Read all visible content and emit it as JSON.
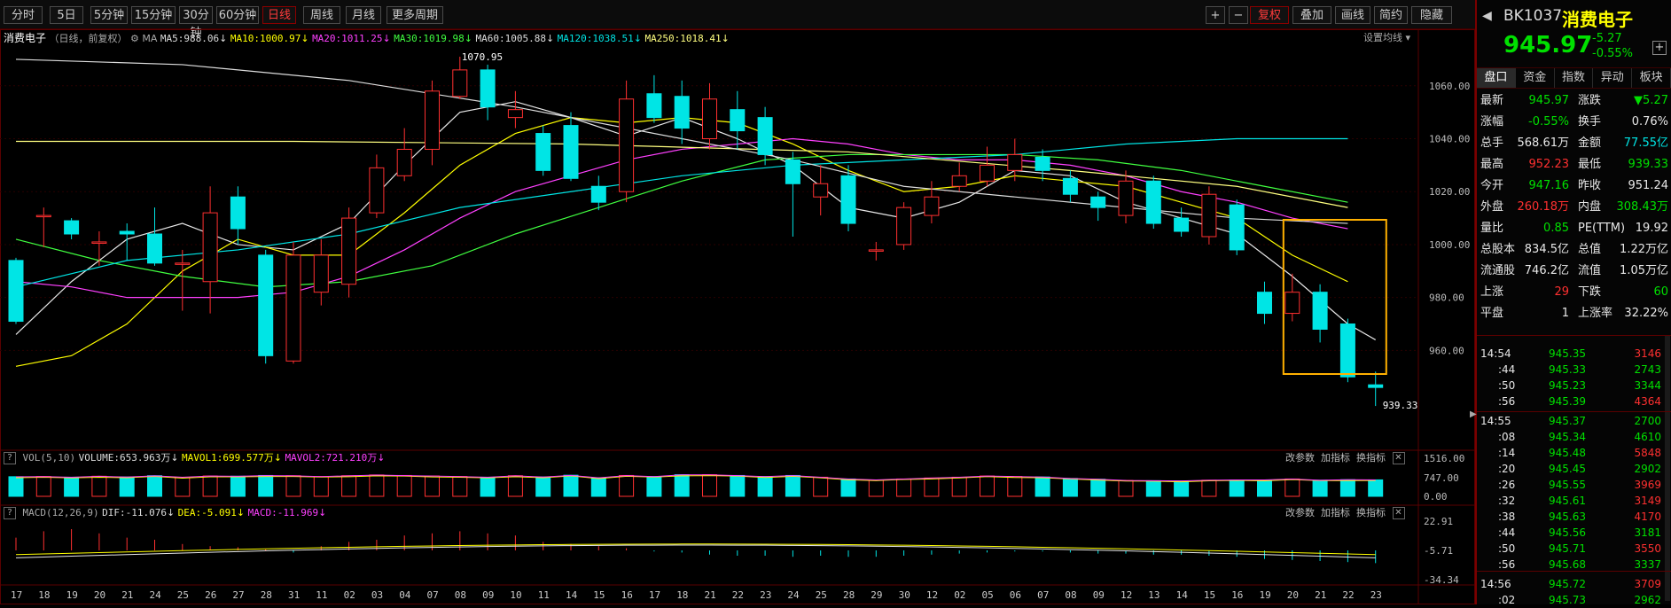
{
  "toolbar": {
    "periods": [
      "分时",
      "5日",
      "5分钟",
      "15分钟",
      "30分钟",
      "60分钟",
      "日线",
      "周线",
      "月线",
      "更多周期"
    ],
    "right_buttons": [
      "+",
      "−",
      "复权",
      "叠加",
      "画线",
      "简约",
      "隐藏"
    ]
  },
  "main_header": {
    "name": "消费电子",
    "mode": "（日线，前复权）",
    "ma_label": "MA",
    "ma5": "MA5:988.06",
    "ma10": "MA10:1000.97",
    "ma20": "MA20:1011.25",
    "ma30": "MA30:1019.98",
    "ma60": "MA60:1005.88",
    "ma120": "MA120:1038.51",
    "ma250": "MA250:1018.41",
    "settings": "设置均线"
  },
  "price_axis": [
    "1060.00",
    "1040.00",
    "1020.00",
    "1000.00",
    "980.00",
    "960.00"
  ],
  "annotations": {
    "high": "1070.95",
    "low": "939.33"
  },
  "vol_header": {
    "label": "VOL(5,10)",
    "volume": "VOLUME:653.963万",
    "mavol1": "MAVOL1:699.577万",
    "mavol2": "MAVOL2:721.210万",
    "actions": [
      "改参数",
      "加指标",
      "换指标"
    ]
  },
  "vol_axis": [
    "1516.00",
    "747.00",
    "0.00"
  ],
  "macd_header": {
    "label": "MACD(12,26,9)",
    "dif": "DIF:-11.076",
    "dea": "DEA:-5.091",
    "macd": "MACD:-11.969",
    "actions": [
      "改参数",
      "加指标",
      "换指标"
    ]
  },
  "macd_axis": [
    "22.91",
    "-5.71",
    "-34.34"
  ],
  "date_axis": [
    "17",
    "18",
    "19",
    "20",
    "21",
    "24",
    "25",
    "26",
    "27",
    "28",
    "31",
    "11",
    "02",
    "03",
    "04",
    "07",
    "08",
    "09",
    "10",
    "11",
    "14",
    "15",
    "16",
    "17",
    "18",
    "21",
    "22",
    "23",
    "24",
    "25",
    "28",
    "29",
    "30",
    "12",
    "02",
    "05",
    "06",
    "07",
    "08",
    "09",
    "12",
    "13",
    "14",
    "15",
    "16",
    "19",
    "20",
    "21",
    "22",
    "23"
  ],
  "stock": {
    "code": "BK1037",
    "name": "消费电子",
    "price": "945.97",
    "change": "-5.27",
    "change_pct": "-0.55%"
  },
  "right_tabs": [
    "盘口",
    "资金",
    "指数",
    "异动",
    "板块"
  ],
  "quote_rows": [
    {
      "l1": "最新",
      "v1": "945.97",
      "c1": "green",
      "l2": "涨跌",
      "v2": "▼5.27",
      "c2": "green"
    },
    {
      "l1": "涨幅",
      "v1": "-0.55%",
      "c1": "green",
      "l2": "换手",
      "v2": "0.76%",
      "c2": "white"
    },
    {
      "l1": "总手",
      "v1": "568.61万",
      "c1": "white",
      "l2": "金额",
      "v2": "77.55亿",
      "c2": "cyan"
    },
    {
      "l1": "最高",
      "v1": "952.23",
      "c1": "red",
      "l2": "最低",
      "v2": "939.33",
      "c1b": "",
      "c2": "green"
    },
    {
      "l1": "今开",
      "v1": "947.16",
      "c1": "green",
      "l2": "昨收",
      "v2": "951.24",
      "c2": "white"
    },
    {
      "l1": "外盘",
      "v1": "260.18万",
      "c1": "red",
      "l2": "内盘",
      "v2": "308.43万",
      "c2": "green"
    },
    {
      "l1": "量比",
      "v1": "0.85",
      "c1": "green",
      "l2": "PE(TTM)",
      "v2": "19.92",
      "c2": "white"
    },
    {
      "l1": "总股本",
      "v1": "834.5亿",
      "c1": "white",
      "l2": "总值",
      "v2": "1.22万亿",
      "c2": "white"
    },
    {
      "l1": "流通股",
      "v1": "746.2亿",
      "c1": "white",
      "l2": "流值",
      "v2": "1.05万亿",
      "c2": "white"
    },
    {
      "l1": "上涨",
      "v1": "29",
      "c1": "red",
      "l2": "下跌",
      "v2": "60",
      "c2": "green"
    },
    {
      "l1": "平盘",
      "v1": "1",
      "c1": "white",
      "l2": "上涨率",
      "v2": "32.22%",
      "c2": "white"
    }
  ],
  "ticks": [
    {
      "t": "14:54",
      "p": "945.35",
      "v": "3146",
      "vc": "red"
    },
    {
      "t": ":44",
      "p": "945.33",
      "v": "2743",
      "vc": "green"
    },
    {
      "t": ":50",
      "p": "945.23",
      "v": "3344",
      "vc": "green"
    },
    {
      "t": ":56",
      "p": "945.39",
      "v": "4364",
      "vc": "red"
    },
    {
      "t": "14:55",
      "p": "945.37",
      "v": "2700",
      "vc": "green"
    },
    {
      "t": ":08",
      "p": "945.34",
      "v": "4610",
      "vc": "green"
    },
    {
      "t": ":14",
      "p": "945.48",
      "v": "5848",
      "vc": "red"
    },
    {
      "t": ":20",
      "p": "945.45",
      "v": "2902",
      "vc": "green"
    },
    {
      "t": ":26",
      "p": "945.55",
      "v": "3969",
      "vc": "red"
    },
    {
      "t": ":32",
      "p": "945.61",
      "v": "3149",
      "vc": "red"
    },
    {
      "t": ":38",
      "p": "945.63",
      "v": "4170",
      "vc": "red"
    },
    {
      "t": ":44",
      "p": "945.56",
      "v": "3181",
      "vc": "green"
    },
    {
      "t": ":50",
      "p": "945.71",
      "v": "3550",
      "vc": "red"
    },
    {
      "t": ":56",
      "p": "945.68",
      "v": "3337",
      "vc": "green"
    },
    {
      "t": "14:56",
      "p": "945.72",
      "v": "3709",
      "vc": "red"
    },
    {
      "t": ":02",
      "p": "945.73",
      "v": "2962",
      "vc": "green"
    }
  ],
  "chart_data": {
    "type": "candlestick",
    "ylim": [
      934,
      1074
    ],
    "candles": [
      [
        994,
        971,
        995,
        970
      ],
      [
        1011,
        1011,
        1014,
        999
      ],
      [
        1009,
        1004,
        1010,
        1002
      ],
      [
        1001,
        1001,
        1005,
        992
      ],
      [
        1005,
        1004,
        1008,
        994
      ],
      [
        1004,
        993,
        1014,
        992
      ],
      [
        993,
        993,
        998,
        975
      ],
      [
        986,
        1012,
        1022,
        974
      ],
      [
        1018,
        1006,
        1022,
        1000
      ],
      [
        996,
        958,
        998,
        955
      ],
      [
        956,
        996,
        1001,
        955
      ],
      [
        982,
        996,
        1002,
        977
      ],
      [
        985,
        1010,
        1014,
        980
      ],
      [
        1012,
        1029,
        1034,
        1010
      ],
      [
        1026,
        1036,
        1044,
        1024
      ],
      [
        1036,
        1058,
        1062,
        1030
      ],
      [
        1056,
        1066,
        1071,
        1055
      ],
      [
        1066,
        1052,
        1068,
        1047
      ],
      [
        1048,
        1051,
        1058,
        1044
      ],
      [
        1042,
        1028,
        1045,
        1026
      ],
      [
        1045,
        1025,
        1050,
        1024
      ],
      [
        1022,
        1016,
        1026,
        1013
      ],
      [
        1020,
        1055,
        1062,
        1016
      ],
      [
        1057,
        1048,
        1064,
        1046
      ],
      [
        1056,
        1044,
        1062,
        1038
      ],
      [
        1040,
        1055,
        1061,
        1036
      ],
      [
        1051,
        1043,
        1058,
        1036
      ],
      [
        1048,
        1034,
        1052,
        1030
      ],
      [
        1032,
        1023,
        1035,
        1003
      ],
      [
        1018,
        1023,
        1030,
        1011
      ],
      [
        1026,
        1008,
        1030,
        1005
      ],
      [
        998,
        998,
        1001,
        994
      ],
      [
        1000,
        1014,
        1016,
        998
      ],
      [
        1011,
        1018,
        1024,
        1008
      ],
      [
        1022,
        1026,
        1031,
        1020
      ],
      [
        1024,
        1030,
        1037,
        1022
      ],
      [
        1028,
        1034,
        1040,
        1024
      ],
      [
        1033,
        1028,
        1036,
        1024
      ],
      [
        1025,
        1019,
        1028,
        1016
      ],
      [
        1018,
        1014,
        1020,
        1009
      ],
      [
        1011,
        1024,
        1028,
        1008
      ],
      [
        1024,
        1008,
        1026,
        1006
      ],
      [
        1010,
        1005,
        1014,
        1003
      ],
      [
        1003,
        1019,
        1022,
        1000
      ],
      [
        1015,
        998,
        1017,
        996
      ],
      [
        982,
        974,
        986,
        970
      ],
      [
        974,
        982,
        989,
        971
      ],
      [
        982,
        968,
        985,
        963
      ],
      [
        970,
        950,
        972,
        948
      ],
      [
        947,
        946,
        952,
        939
      ]
    ],
    "volume": [
      780,
      790,
      760,
      800,
      770,
      820,
      760,
      810,
      800,
      830,
      820,
      790,
      820,
      850,
      830,
      810,
      790,
      760,
      820,
      770,
      840,
      740,
      830,
      790,
      860,
      860,
      830,
      790,
      830,
      760,
      690,
      650,
      690,
      730,
      760,
      810,
      790,
      770,
      710,
      680,
      630,
      620,
      610,
      640,
      650,
      650,
      690,
      640,
      660,
      654
    ],
    "macd_bars": [
      12,
      18,
      20,
      16,
      12,
      10,
      6,
      4,
      3,
      1,
      -2,
      4,
      8,
      10,
      14,
      16,
      18,
      16,
      14,
      8,
      6,
      4,
      2,
      -1,
      -2,
      -4,
      -5,
      -5,
      -6,
      -5,
      -6,
      -6,
      -5,
      -4,
      -3,
      -2,
      -1,
      -1,
      -2,
      -3,
      -3,
      -4,
      -4,
      -5,
      -6,
      -8,
      -9,
      -10,
      -11,
      -11.969
    ]
  }
}
